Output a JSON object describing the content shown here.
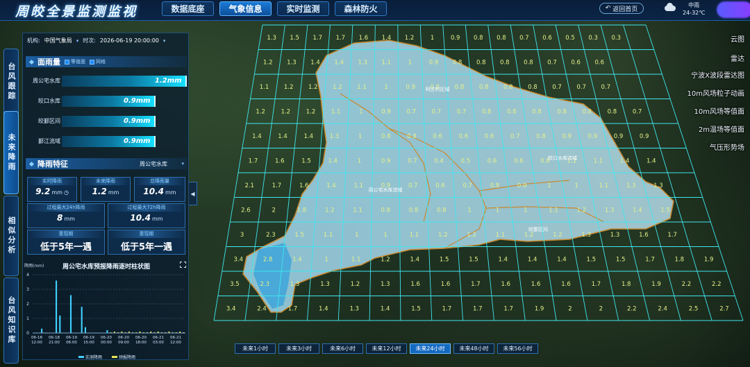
{
  "header": {
    "title": "周皎全景监测监视",
    "tabs": [
      {
        "label": "数据底座",
        "active": false
      },
      {
        "label": "气象信息",
        "active": true
      },
      {
        "label": "实时监测",
        "active": false
      },
      {
        "label": "森林防火",
        "active": false
      }
    ],
    "back_label": "返回首页",
    "weather": {
      "condition": "中雨",
      "temp": "24-32℃",
      "icon": "cloud-icon"
    }
  },
  "vtabs": [
    {
      "label": "台风跟踪",
      "active": false
    },
    {
      "label": "未来降雨",
      "active": true
    },
    {
      "label": "相似分析",
      "active": false
    },
    {
      "label": "台风知识库",
      "active": false
    }
  ],
  "filters": {
    "org_label": "机构:",
    "org_value": "中国气象局",
    "time_label": "时次:",
    "time_value": "2026-06-19 20:00:00"
  },
  "areal_rain": {
    "title": "面雨量",
    "options": [
      "等值面",
      "网格"
    ],
    "bars": [
      {
        "label": "周公宅水库",
        "value": "1.2mm",
        "level": 1.2
      },
      {
        "label": "皎口水库",
        "value": "0.9mm",
        "level": 0.9
      },
      {
        "label": "皎鄞区间",
        "value": "0.9mm",
        "level": 0.9
      },
      {
        "label": "鄞江流域",
        "value": "0.9mm",
        "level": 0.9
      }
    ],
    "max_level": 1.2
  },
  "rain_features": {
    "title": "降雨特征",
    "selected": "周公宅水库",
    "cards": [
      {
        "label": "实时降雨",
        "value": "9.2",
        "unit": "mm"
      },
      {
        "label": "未来降雨",
        "value": "1.2",
        "unit": "mm"
      },
      {
        "label": "总降雨量",
        "value": "10.4",
        "unit": "mm"
      },
      {
        "label": "过程最大24h降雨",
        "value": "8",
        "unit": "mm"
      },
      {
        "label": "过程最大72h降雨",
        "value": "10.4",
        "unit": "mm"
      },
      {
        "label": "重现期",
        "value": "低于5年一遇"
      },
      {
        "label": "重现期",
        "value": "低于5年一遇"
      }
    ]
  },
  "chart_data": {
    "type": "bar",
    "title": "周公宅水库预报降雨逐时柱状图",
    "ylabel": "降雨(mm)",
    "ylim": [
      0,
      4
    ],
    "yticks": [
      0,
      1,
      2,
      3,
      4
    ],
    "xticks": [
      "06-18 12:00",
      "06-18 21:00",
      "06-19 06:00",
      "06-19 15:00",
      "06-20 00:00",
      "06-20 09:00",
      "06-20 18:00",
      "06-21 03:00",
      "06-21 12:00"
    ],
    "series": [
      {
        "name": "实测降雨",
        "color": "#3fd0ff",
        "values": [
          0,
          0,
          0.3,
          0,
          0,
          0,
          3.6,
          1.2,
          0,
          0,
          2.6,
          0,
          0,
          1.8,
          0.4,
          0,
          0,
          0,
          0,
          0,
          0.2,
          0,
          0,
          0,
          0,
          0,
          0,
          0,
          0,
          0,
          0,
          0,
          0,
          0,
          0,
          0,
          0,
          0,
          0,
          0,
          0,
          0
        ]
      },
      {
        "name": "预报降雨",
        "color": "#e7e255",
        "values": [
          0,
          0,
          0,
          0,
          0,
          0,
          0,
          0,
          0,
          0,
          0,
          0,
          0,
          0,
          0,
          0,
          0,
          0,
          0,
          0,
          0,
          0.05,
          0.1,
          0.05,
          0.1,
          0.05,
          0.1,
          0.05,
          0.05,
          0.1,
          0.05,
          0.05,
          0.1,
          0.05,
          0.1,
          0.05,
          0.05,
          0.1,
          0.05,
          0.05,
          0.1,
          0.05
        ]
      }
    ]
  },
  "grid": {
    "rows": [
      [
        "1.3",
        "1.5",
        "1.7",
        "1.7",
        "1.6",
        "1.4",
        "1.2",
        "1",
        "0.9",
        "0.8",
        "0.8",
        "0.7",
        "0.6",
        "0.5",
        "0.3",
        "0.3"
      ],
      [
        "1.2",
        "1.3",
        "1.4",
        "1.4",
        "1.3",
        "1.1",
        "1",
        "0.9",
        "0.8",
        "0.8",
        "0.8",
        "0.8",
        "0.7",
        "0.6",
        "0.6",
        ""
      ],
      [
        "1.1",
        "1.2",
        "1.2",
        "1.2",
        "1.1",
        "1",
        "0.9",
        "0.8",
        "0.8",
        "0.8",
        "0.8",
        "0.8",
        "0.7",
        "0.7",
        "0.7",
        ""
      ],
      [
        "1.2",
        "1.2",
        "1.2",
        "1.1",
        "1",
        "0.9",
        "0.7",
        "0.7",
        "0.7",
        "0.8",
        "0.8",
        "0.8",
        "0.8",
        "0.8",
        "0.8",
        "0.7"
      ],
      [
        "1.4",
        "1.4",
        "1.4",
        "1.3",
        "1",
        "0.8",
        "0.8",
        "0.6",
        "0.6",
        "0.6",
        "0.7",
        "0.8",
        "0.9",
        "0.9",
        "0.9",
        "0.9"
      ],
      [
        "1.7",
        "1.6",
        "1.5",
        "1.4",
        "1",
        "0.9",
        "0.7",
        "0.4",
        "0.5",
        "0.6",
        "0.6",
        "0.8",
        "1.1",
        "1.1",
        "1.4",
        "1.4"
      ],
      [
        "2.1",
        "1.7",
        "1.6",
        "1.4",
        "1.1",
        "0.9",
        "0.7",
        "0.6",
        "0.7",
        "0.8",
        "0.9",
        "1",
        "1",
        "1.1",
        "1.3",
        "1.3"
      ],
      [
        "2.6",
        "2",
        "1.8",
        "1.2",
        "1.1",
        "0.8",
        "0.8",
        "0.8",
        "1",
        "1",
        "1",
        "1.1",
        "1.2",
        "1.3",
        "1.4",
        "1.5"
      ],
      [
        "3",
        "2.3",
        "1.5",
        "1.1",
        "1",
        "1",
        "1.1",
        "1.2",
        "1.2",
        "1.1",
        "1.2",
        "1.2",
        "1.3",
        "1.3",
        "1.6",
        "1.7"
      ],
      [
        "3.4",
        "2.8",
        "1.4",
        "1",
        "1.1",
        "1.2",
        "1.4",
        "1.5",
        "1.5",
        "1.4",
        "1.4",
        "1.4",
        "1.5",
        "1.5",
        "1.7",
        "1.8",
        "1.9"
      ],
      [
        "3.5",
        "2.3",
        "1.3",
        "1.3",
        "1.2",
        "1.3",
        "1.6",
        "1.6",
        "1.7",
        "1.6",
        "1.6",
        "1.6",
        "1.7",
        "1.8",
        "1.9",
        "2.2",
        "2.2"
      ],
      [
        "3.4",
        "2.4",
        "1.7",
        "1.4",
        "1.3",
        "1.4",
        "1.5",
        "1.7",
        "1.7",
        "1.7",
        "1.9",
        "2",
        "2",
        "2.2",
        "2.4",
        "2.5",
        "2.7"
      ]
    ],
    "place_labels": [
      "阿庄村区域",
      "周公宅水库流域",
      "皎口水库流域",
      "皎鄞区间"
    ]
  },
  "layers": [
    "云图",
    "雷达",
    "宁波X波段雷达图",
    "10m风场粒子动画",
    "10m风场等值面",
    "2m温场等值面",
    "气压形势场"
  ],
  "time_buttons": [
    {
      "label": "未来1小时",
      "active": false
    },
    {
      "label": "未来3小时",
      "active": false
    },
    {
      "label": "未来6小时",
      "active": false
    },
    {
      "label": "未来12小时",
      "active": false
    },
    {
      "label": "未来24小时",
      "active": true
    },
    {
      "label": "未来48小时",
      "active": false
    },
    {
      "label": "未来56小时",
      "active": false
    }
  ]
}
